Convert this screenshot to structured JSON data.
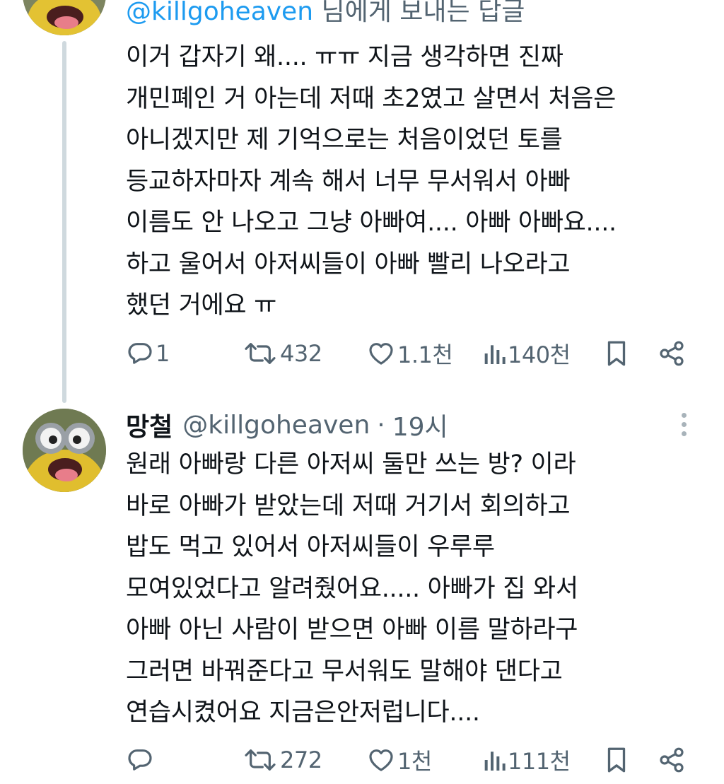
{
  "tweet1": {
    "reply_prefix": "@killgoheaven",
    "reply_suffix": " 님에게 보내는 답글",
    "lines": [
      "이거 갑자기 왜.... ㅠㅠ 지금 생각하면 진짜",
      "개민폐인 거 아는데 저때 초2였고 살면서 처음은",
      "아니겠지만 제 기억으로는 처음이었던 토를",
      "등교하자마자 계속 해서 너무 무서워서 아빠",
      "이름도 안 나오고 그냥 아빠여.... 아빠 아빠요....",
      "하고 울어서 아저씨들이 아빠 빨리 나오라고",
      "했던 거에요 ㅠ"
    ],
    "stats": {
      "replies": "1",
      "retweets": "432",
      "likes": "1.1천",
      "views": "140천"
    }
  },
  "tweet2": {
    "display_name": "망철",
    "handle": "@killgoheaven",
    "separator": "·",
    "time": "19시",
    "lines": [
      "원래 아빠랑 다른 아저씨 둘만 쓰는 방? 이라",
      "바로 아빠가 받았는데 저때 거기서 회의하고",
      "밥도 먹고 있어서 아저씨들이 우루루",
      "모여있었다고 알려줬어요..... 아빠가 집 와서",
      "아빠 아닌 사람이 받으면 아빠 이름 말하라구",
      "그러면 바꿔준다고 무서워도 말해야 댄다고",
      "연습시켰어요 지금은안저럽니다...."
    ],
    "stats": {
      "replies": "",
      "retweets": "272",
      "likes": "1천",
      "views": "111천"
    }
  },
  "colors": {
    "text": "#0f1419",
    "muted": "#536471",
    "link": "#1d9bf0",
    "thread_line": "#cfd9de"
  },
  "icons": [
    "reply-icon",
    "retweet-icon",
    "like-icon",
    "views-icon",
    "bookmark-icon",
    "share-icon",
    "more-icon"
  ]
}
